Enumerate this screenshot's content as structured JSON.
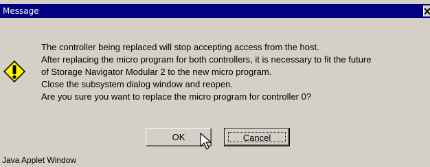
{
  "window": {
    "title": "Message",
    "close_glyph": "×"
  },
  "icon": {
    "name": "warning-icon",
    "color": "#ffff00"
  },
  "message": {
    "lines": [
      "The controller being replaced will stop accepting access from the host.",
      "After replacing the micro program for both controllers, it is necessary to fit the future",
      "of Storage Navigator Modular 2 to the new micro program.",
      "Close the subsystem dialog window and reopen.",
      "Are you sure you want to replace the micro program for controller 0?"
    ]
  },
  "buttons": {
    "ok_label": "OK",
    "cancel_label": "Cancel"
  },
  "footer": {
    "label": "Java Applet Window"
  },
  "colors": {
    "titlebar": "#000080",
    "face": "#d4d0c8"
  }
}
